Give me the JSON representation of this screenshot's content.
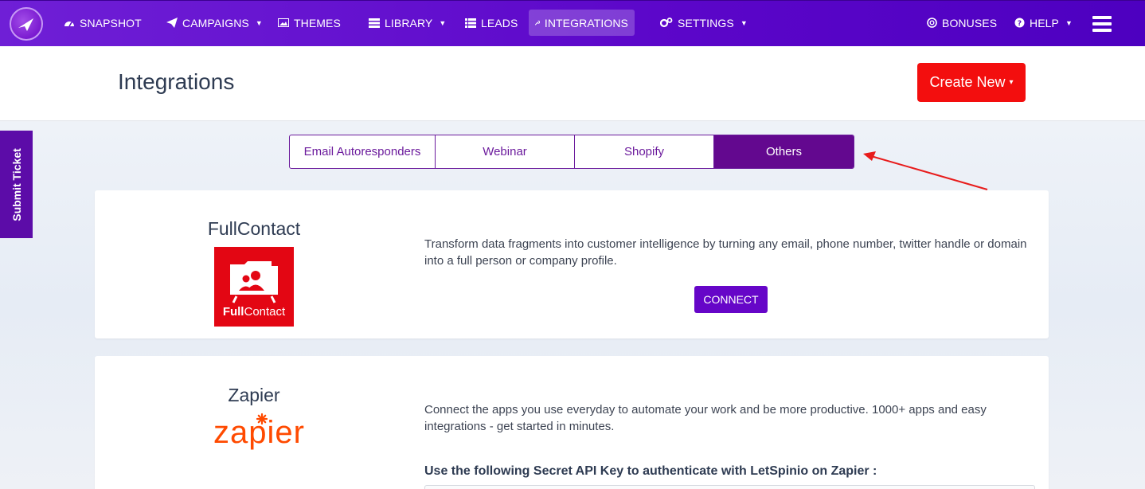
{
  "nav": {
    "items": [
      {
        "label": "SNAPSHOT",
        "icon": "dashboard-icon"
      },
      {
        "label": "CAMPAIGNS",
        "icon": "paper-plane-icon",
        "dropdown": true
      },
      {
        "label": "THEMES",
        "icon": "image-icon"
      },
      {
        "label": "LIBRARY",
        "icon": "server-icon",
        "dropdown": true
      },
      {
        "label": "LEADS",
        "icon": "list-icon"
      },
      {
        "label": "INTEGRATIONS",
        "icon": "wrench-icon",
        "active": true
      },
      {
        "label": "SETTINGS",
        "icon": "cogs-icon",
        "dropdown": true
      }
    ],
    "right": [
      {
        "label": "BONUSES",
        "icon": "life-ring-icon"
      },
      {
        "label": "HELP",
        "icon": "question-circle-icon",
        "dropdown": true
      }
    ],
    "menu_icon": "hamburger-icon"
  },
  "header": {
    "title": "Integrations",
    "create_label": "Create New"
  },
  "ticket_label": "Submit Ticket",
  "tabs": [
    {
      "label": "Email Autoresponders"
    },
    {
      "label": "Webinar"
    },
    {
      "label": "Shopify"
    },
    {
      "label": "Others",
      "active": true
    }
  ],
  "integrations": [
    {
      "title": "FullContact",
      "logo_text_bold": "Full",
      "logo_text": "Contact",
      "description": "Transform data fragments into customer intelligence by turning any email, phone number, twitter handle or domain into a full person or company profile.",
      "button": "CONNECT"
    },
    {
      "title": "Zapier",
      "logo_text": "zapier",
      "description": "Connect the apps you use everyday to automate your work and be more productive. 1000+ apps and easy integrations - get started in minutes.",
      "api_label": "Use the following Secret API Key to authenticate with LetSpinio on Zapier :"
    }
  ],
  "colors": {
    "nav": "#5b06c9",
    "accent": "#63088f",
    "create": "#f30e0e",
    "connect": "#6606c8",
    "fullcontact": "#e30613",
    "zapier": "#ff4a00",
    "annotation_arrow": "#e81b1b"
  }
}
